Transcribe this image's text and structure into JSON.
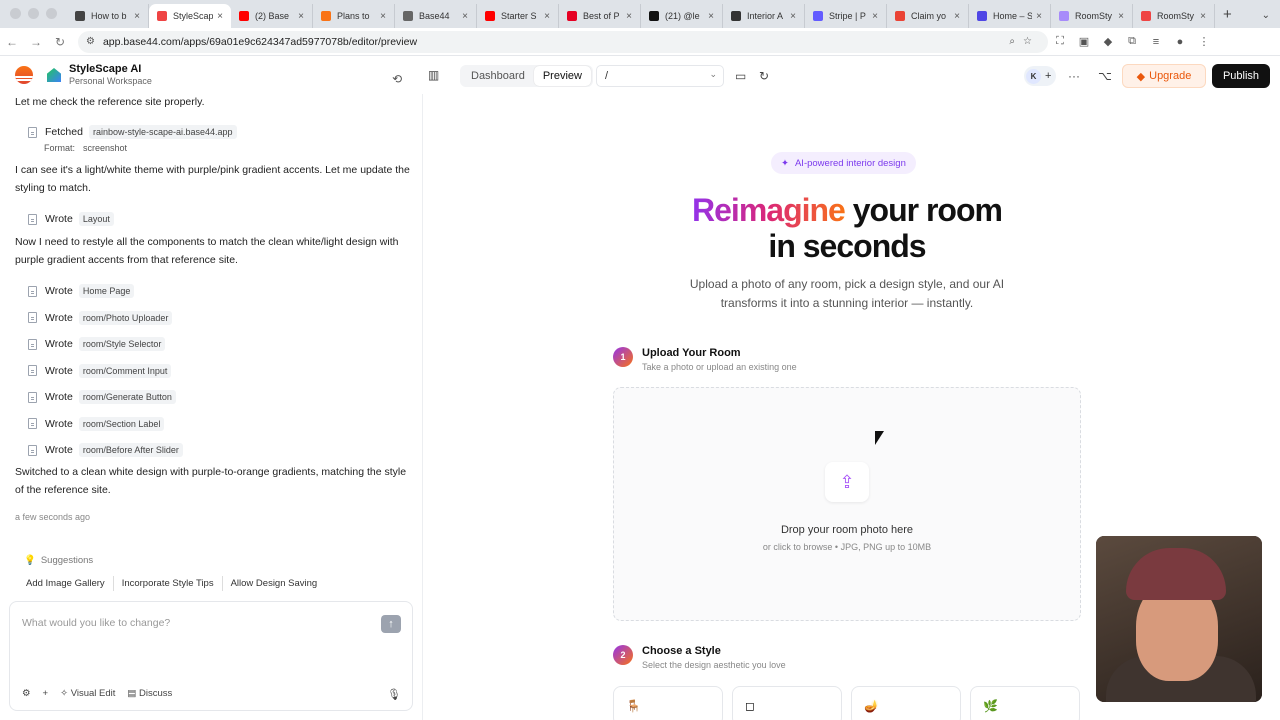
{
  "browser": {
    "tabs": [
      {
        "title": "How to b",
        "color": "#444"
      },
      {
        "title": "StyleScap",
        "color": "#ef4444",
        "active": true
      },
      {
        "title": "(2) Base",
        "color": "#ff0000"
      },
      {
        "title": "Plans to",
        "color": "#f97316"
      },
      {
        "title": "Base44",
        "color": "#666"
      },
      {
        "title": "Starter S",
        "color": "#ff0000"
      },
      {
        "title": "Best of P",
        "color": "#e60023"
      },
      {
        "title": "(21) @le",
        "color": "#111"
      },
      {
        "title": "Interior A",
        "color": "#333"
      },
      {
        "title": "Stripe | P",
        "color": "#635bff"
      },
      {
        "title": "Claim yo",
        "color": "#ea4335"
      },
      {
        "title": "Home – S",
        "color": "#4f46e5"
      },
      {
        "title": "RoomSty",
        "color": "#a78bfa"
      },
      {
        "title": "RoomSty",
        "color": "#ef4444"
      }
    ],
    "url": "app.base44.com/apps/69a01e9c624347ad5977078b/editor/preview"
  },
  "app": {
    "workspace_title": "StyleScape AI",
    "workspace_sub": "Personal Workspace",
    "seg_dashboard": "Dashboard",
    "seg_preview": "Preview",
    "route": "/",
    "avatar_initial": "K",
    "upgrade": "Upgrade",
    "publish": "Publish"
  },
  "chat": {
    "msg1": "Let me check the reference site properly.",
    "fetched_label": "Fetched",
    "fetched_tag": "rainbow-style-scape-ai.base44.app",
    "format_label": "Format:",
    "format_value": "screenshot",
    "msg2": "I can see it's a light/white theme with purple/pink gradient accents. Let me update the styling to match.",
    "wrote_label": "Wrote",
    "w_layout": "Layout",
    "msg3": "Now I need to restyle all the components to match the clean white/light design with purple gradient accents from that reference site.",
    "writes": [
      "Home Page",
      "room/Photo Uploader",
      "room/Style Selector",
      "room/Comment Input",
      "room/Generate Button",
      "room/Section Label",
      "room/Before After Slider"
    ],
    "msg4": "Switched to a clean white design with purple-to-orange gradients, matching the style of the reference site.",
    "ago": "a few seconds ago",
    "suggestions_label": "Suggestions",
    "suggestions": [
      "Add Image Gallery",
      "Incorporate Style Tips",
      "Allow Design Saving"
    ],
    "placeholder": "What would you like to change?",
    "visual_edit": "Visual Edit",
    "discuss": "Discuss"
  },
  "preview": {
    "badge": "AI-powered interior design",
    "hero_grad": "Reimagine",
    "hero_rest1": " your room",
    "hero_line2": "in seconds",
    "subtitle": "Upload a photo of any room, pick a design style, and our AI transforms it into a stunning interior — instantly.",
    "step1_num": "1",
    "step1_title": "Upload Your Room",
    "step1_desc": "Take a photo or upload an existing one",
    "drop_title": "Drop your room photo here",
    "drop_sub": "or click to browse • JPG, PNG up to 10MB",
    "step2_num": "2",
    "step2_title": "Choose a Style",
    "step2_desc": "Select the design aesthetic you love"
  },
  "colors": {
    "accent_purple": "#9333ea",
    "accent_orange": "#f97316",
    "publish_bg": "#111111",
    "upgrade_text": "#ea580c"
  }
}
